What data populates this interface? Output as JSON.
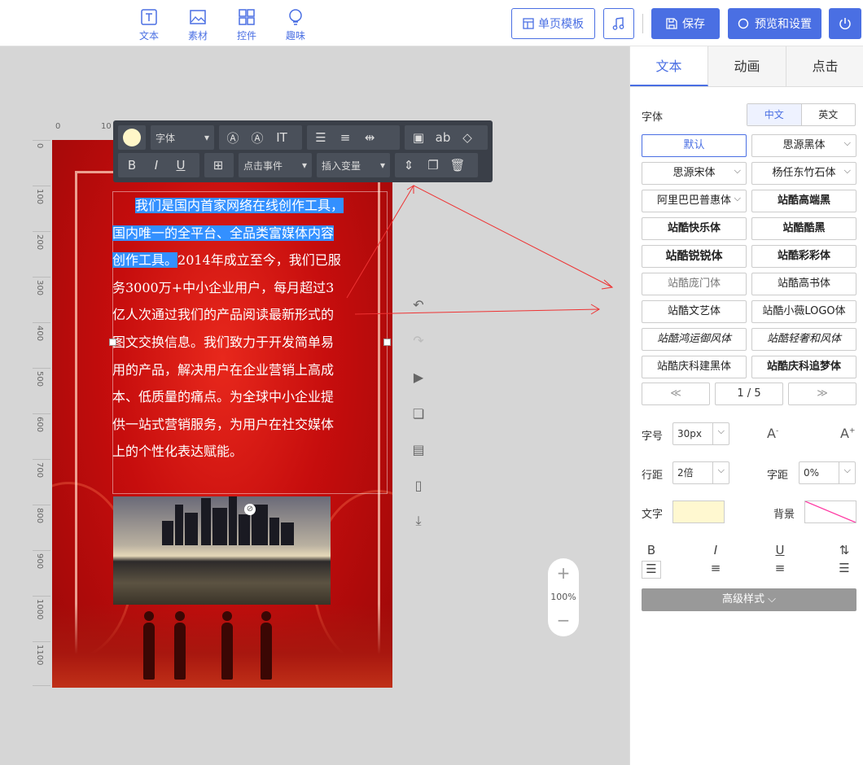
{
  "topbar": {
    "tools": [
      {
        "label": "文本",
        "icon": "text-icon"
      },
      {
        "label": "素材",
        "icon": "image-icon"
      },
      {
        "label": "控件",
        "icon": "widgets-icon"
      },
      {
        "label": "趣味",
        "icon": "bulb-icon"
      }
    ],
    "template_label": "单页模板",
    "save_label": "保存",
    "preview_label": "预览和设置"
  },
  "canvas": {
    "ruler_h": [
      "0",
      "10"
    ],
    "ruler_v": [
      "0",
      "100",
      "200",
      "300",
      "400",
      "500",
      "600",
      "700",
      "800",
      "900",
      "1000",
      "1100"
    ],
    "text_selected": "我们是国内首家网络在线创作工具，国内唯一的全平台、全品类富媒体内容创作工具。",
    "text_rest": "2014年成立至今，我们已服务3000万+中小企业用户，每月超过3亿人次通过我们的产品阅读最新形式的图文交换信息。我们致力于开发简单易用的产品，解决用户在企业营销上高成本、低质量的痛点。为全球中小企业提供一站式营销服务，为用户在社交媒体上的个性化表达赋能。",
    "zoom": "100%"
  },
  "floating_toolbar": {
    "font_label": "字体",
    "event_label": "点击事件",
    "variable_label": "插入变量",
    "bold": "B",
    "italic": "I",
    "underline": "U"
  },
  "panel": {
    "tabs": [
      "文本",
      "动画",
      "点击"
    ],
    "font_label": "字体",
    "lang": [
      "中文",
      "英文"
    ],
    "fonts": [
      "默认",
      "思源黑体",
      "思源宋体",
      "杨任东竹石体",
      "阿里巴巴普惠体",
      "站酷高端黑",
      "站酷快乐体",
      "站酷酷黑",
      "站酷锐锐体",
      "站酷彩彩体",
      "站酷庞门体",
      "站酷高书体",
      "站酷文艺体",
      "站酷小薇LOGO体",
      "站酷鸿运御风体",
      "站酷轻奢和风体",
      "站酷庆科建黑体",
      "站酷庆科追梦体"
    ],
    "pager": {
      "prev": "≪",
      "page": "1 / 5",
      "next": "≫"
    },
    "size_label": "字号",
    "size_value": "30px",
    "line_label": "行距",
    "line_value": "2倍",
    "spacing_label": "字距",
    "spacing_value": "0%",
    "text_color_label": "文字",
    "bg_label": "背景",
    "text_color": "#fff8d0",
    "advanced_label": "高级样式",
    "accent": "#4a6fe3"
  }
}
